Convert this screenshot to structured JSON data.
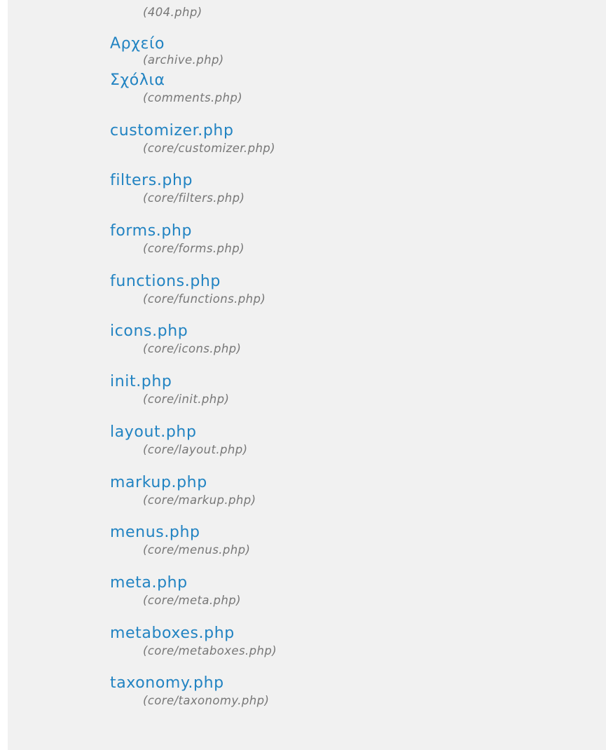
{
  "partial_item": {
    "path": "(404.php)"
  },
  "files": [
    {
      "name": "Αρχείο",
      "path": "(archive.php)"
    },
    {
      "name": "Σχόλια",
      "path": "(comments.php)"
    },
    {
      "name": "customizer.php",
      "path": "(core/customizer.php)"
    },
    {
      "name": "filters.php",
      "path": "(core/filters.php)"
    },
    {
      "name": "forms.php",
      "path": "(core/forms.php)"
    },
    {
      "name": "functions.php",
      "path": "(core/functions.php)"
    },
    {
      "name": "icons.php",
      "path": "(core/icons.php)"
    },
    {
      "name": "init.php",
      "path": "(core/init.php)"
    },
    {
      "name": "layout.php",
      "path": "(core/layout.php)"
    },
    {
      "name": "markup.php",
      "path": "(core/markup.php)"
    },
    {
      "name": "menus.php",
      "path": "(core/menus.php)"
    },
    {
      "name": "meta.php",
      "path": "(core/meta.php)"
    },
    {
      "name": "metaboxes.php",
      "path": "(core/metaboxes.php)"
    },
    {
      "name": "taxonomy.php",
      "path": "(core/taxonomy.php)"
    }
  ],
  "colors": {
    "link": "#2183c2",
    "path": "#777777",
    "panel_bg": "#f1f1f1"
  }
}
